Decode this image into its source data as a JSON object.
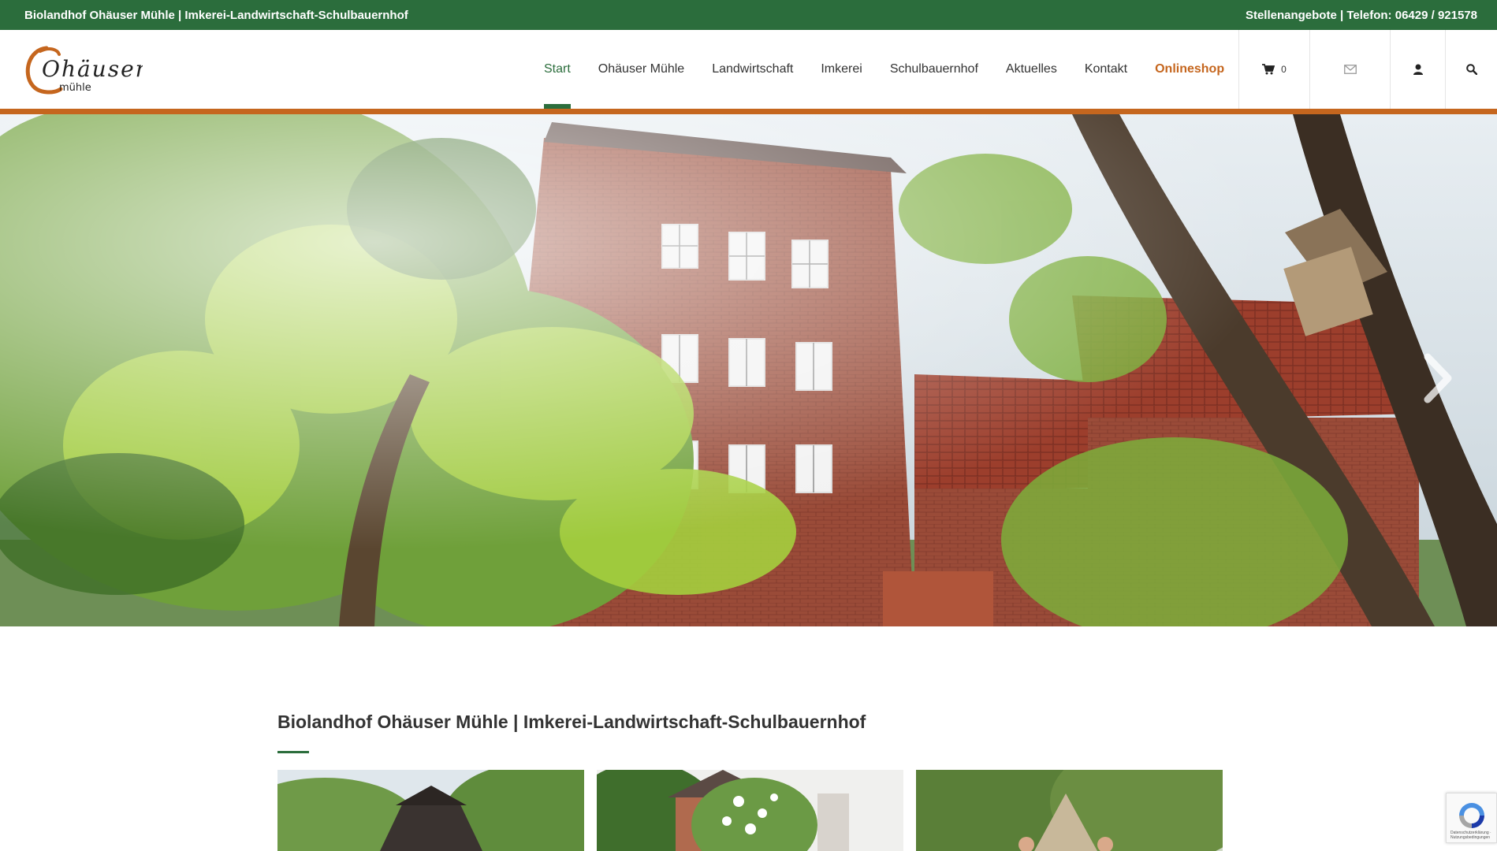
{
  "topbar": {
    "left_text": "Biolandhof Ohäuser Mühle | Imkerei-Landwirtschaft-Schulbauernhof",
    "right_text": "Stellenangebote | Telefon: 06429 / 921578"
  },
  "logo": {
    "word": "Ohäuser",
    "sub": "mühle"
  },
  "nav": {
    "items": [
      {
        "label": "Start"
      },
      {
        "label": "Ohäuser Mühle"
      },
      {
        "label": "Landwirtschaft"
      },
      {
        "label": "Imkerei"
      },
      {
        "label": "Schulbauernhof"
      },
      {
        "label": "Aktuelles"
      },
      {
        "label": "Kontakt"
      },
      {
        "label": "Onlineshop"
      }
    ]
  },
  "header": {
    "cart_count": "0"
  },
  "content": {
    "title": "Biolandhof Ohäuser Mühle | Imkerei-Landwirtschaft-Schulbauernhof"
  },
  "recaptcha": {
    "text": "Datenschutzerklärung · Nutzungsbedingungen"
  },
  "colors": {
    "brand_green": "#2b6d3c",
    "accent_orange": "#c5661e"
  }
}
